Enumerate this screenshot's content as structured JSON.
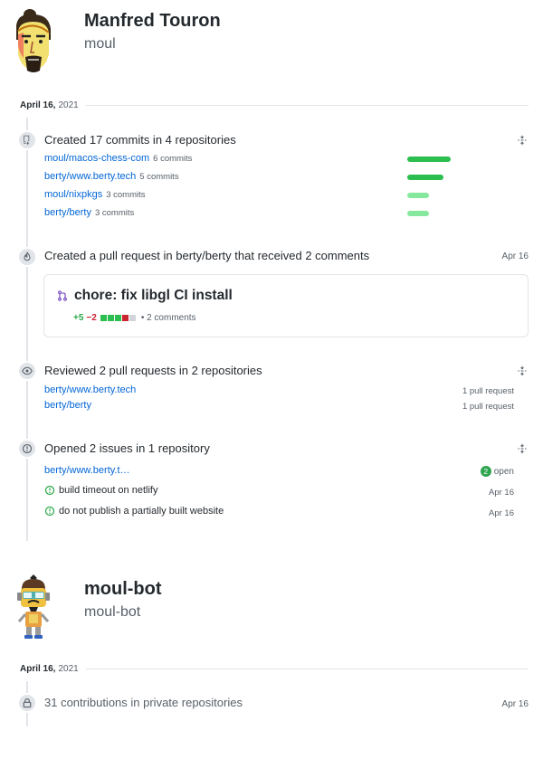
{
  "user1": {
    "name": "Manfred Touron",
    "login": "moul"
  },
  "section1": {
    "date_month": "April 16,",
    "date_year": "2021",
    "commits_event": {
      "title": "Created 17 commits in 4 repositories",
      "repos": [
        {
          "name": "moul/macos-chess-com",
          "count": "6 commits",
          "level": 6,
          "color": "#2cbe4e"
        },
        {
          "name": "berty/www.berty.tech",
          "count": "5 commits",
          "level": 5,
          "color": "#2cbe4e"
        },
        {
          "name": "moul/nixpkgs",
          "count": "3 commits",
          "level": 3,
          "color": "#85e89d"
        },
        {
          "name": "berty/berty",
          "count": "3 commits",
          "level": 3,
          "color": "#85e89d"
        }
      ]
    },
    "pr_event": {
      "title": "Created a pull request in berty/berty that received 2 comments",
      "date": "Apr 16",
      "pr_title": "chore: fix libgl CI install",
      "additions": "+5",
      "deletions": "−2",
      "comments": "• 2 comments"
    },
    "review_event": {
      "title": "Reviewed 2 pull requests in 2 repositories",
      "repos": [
        {
          "name": "berty/www.berty.tech",
          "count": "1 pull request"
        },
        {
          "name": "berty/berty",
          "count": "1 pull request"
        }
      ]
    },
    "issues_event": {
      "title": "Opened 2 issues in 1 repository",
      "repo": "berty/www.berty.t…",
      "open_count": "2",
      "open_label": "open",
      "issues": [
        {
          "title": "build timeout on netlify",
          "date": "Apr 16"
        },
        {
          "title": "do not publish a partially built website",
          "date": "Apr 16"
        }
      ]
    }
  },
  "user2": {
    "name": "moul-bot",
    "login": "moul-bot"
  },
  "section2": {
    "date_month": "April 16,",
    "date_year": "2021",
    "private_event": {
      "title": "31 contributions in private repositories",
      "date": "Apr 16"
    }
  },
  "colors": {
    "link": "#0366d6",
    "add": "#28a745",
    "del": "#cb2431",
    "bar_strong": "#2cbe4e",
    "bar_light": "#85e89d"
  },
  "icons": [
    "repo-push-icon",
    "flame-icon",
    "eye-icon",
    "issue-icon",
    "fold-icon",
    "pull-request-icon",
    "issue-opened-icon",
    "lock-icon"
  ]
}
